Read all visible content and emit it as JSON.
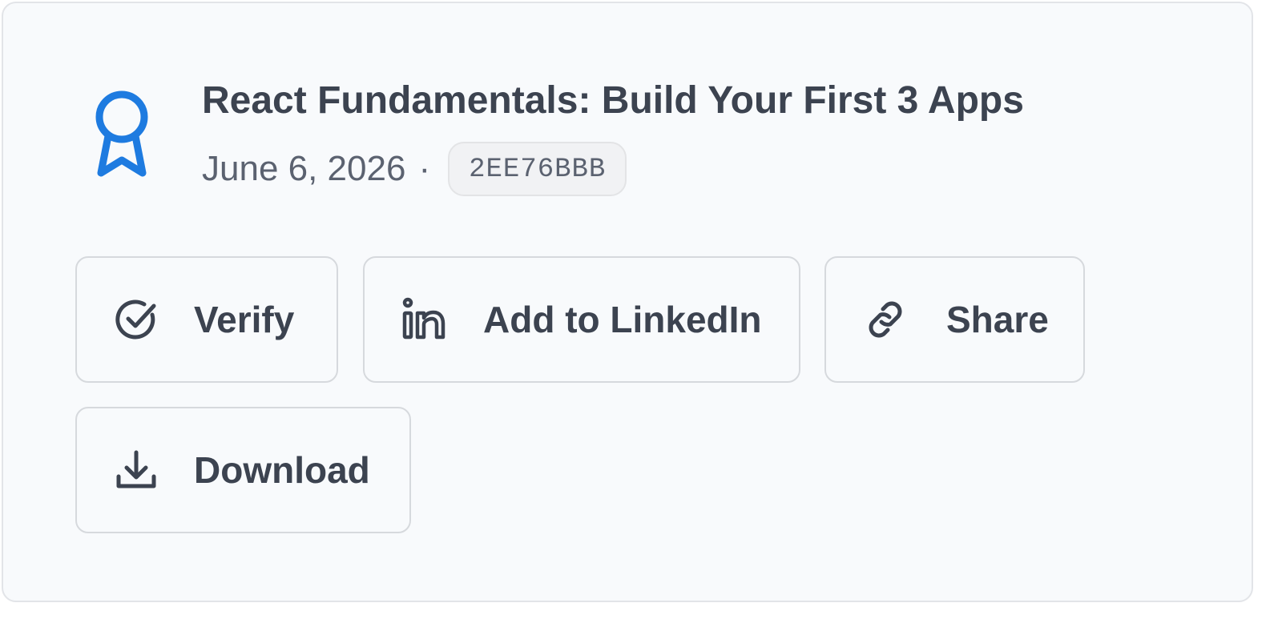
{
  "certificate": {
    "title": "React Fundamentals: Build Your First 3 Apps",
    "date": "June 6, 2026",
    "separator": "·",
    "code": "2EE76BBB",
    "icon": "award-ribbon-icon"
  },
  "actions": {
    "verify": {
      "label": "Verify",
      "icon": "check-circle-icon"
    },
    "linkedin": {
      "label": "Add to LinkedIn",
      "icon": "linkedin-icon"
    },
    "share": {
      "label": "Share",
      "icon": "link-icon"
    },
    "download": {
      "label": "Download",
      "icon": "download-icon"
    }
  },
  "colors": {
    "accent": "#1e7be0",
    "text": "#3c4350",
    "muted": "#5b6270",
    "card_bg": "#f8fafc",
    "border": "#d6d9dd"
  }
}
